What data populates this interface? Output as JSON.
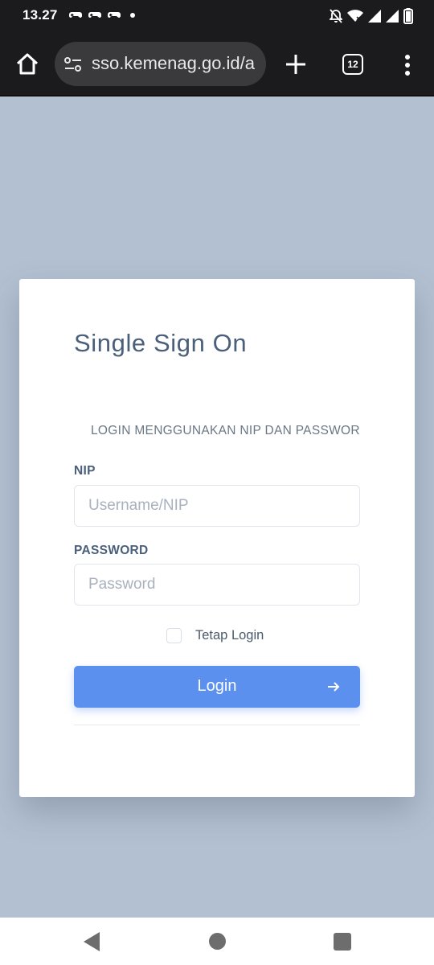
{
  "status_bar": {
    "time": "13.27",
    "notification_icons": [
      "game-controller-icon",
      "game-controller-icon",
      "game-controller-icon",
      "dot-icon"
    ],
    "system_icons": [
      "mute-notifications-icon",
      "wifi-icon",
      "signal-icon",
      "signal-icon",
      "battery-icon"
    ]
  },
  "browser": {
    "url": "sso.kemenag.go.id/a",
    "tab_count": "12"
  },
  "login_card": {
    "title": "Single Sign On",
    "subtitle": "LOGIN MENGGUNAKAN NIP DAN PASSWORD",
    "nip_label": "NIP",
    "nip_placeholder": "Username/NIP",
    "nip_value": "",
    "password_label": "PASSWORD",
    "password_placeholder": "Password",
    "password_value": "",
    "remember_label": "Tetap Login",
    "remember_checked": false,
    "login_button_label": "Login"
  },
  "colors": {
    "page_background": "#b3c0d1",
    "accent": "#5b90ee",
    "title_text": "#4a5f7a",
    "chrome_dark": "#1b1b1d"
  }
}
